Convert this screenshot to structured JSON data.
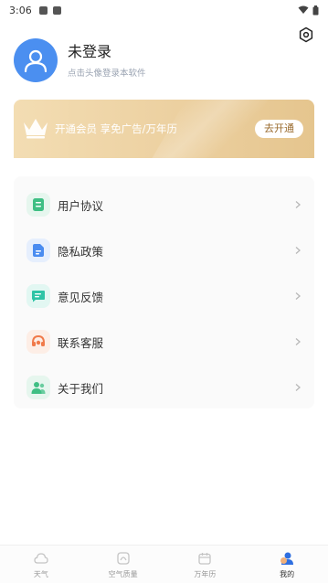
{
  "status_bar": {
    "time": "3:06"
  },
  "profile": {
    "name": "未登录",
    "hint": "点击头像登录本软件"
  },
  "vip": {
    "text": "开通会员 享免广告/万年历",
    "button": "去开通"
  },
  "menu": {
    "items": [
      {
        "label": "用户协议",
        "icon": "document-icon",
        "color": "#3fbf84",
        "bg": "#e6f6ee"
      },
      {
        "label": "隐私政策",
        "icon": "file-icon",
        "color": "#4a8cf0",
        "bg": "#e6effd"
      },
      {
        "label": "意见反馈",
        "icon": "chat-icon",
        "color": "#2ec4a6",
        "bg": "#e2f7f2"
      },
      {
        "label": "联系客服",
        "icon": "headset-icon",
        "color": "#f07a4a",
        "bg": "#fdeee6"
      },
      {
        "label": "关于我们",
        "icon": "people-icon",
        "color": "#3fbf84",
        "bg": "#e6f6ee"
      }
    ]
  },
  "bottom_nav": {
    "items": [
      {
        "label": "天气",
        "icon": "weather-icon"
      },
      {
        "label": "空气质量",
        "icon": "air-quality-icon"
      },
      {
        "label": "万年历",
        "icon": "calendar-icon"
      },
      {
        "label": "我的",
        "icon": "profile-icon",
        "active": true
      }
    ]
  },
  "colors": {
    "accent": "#4b8ff0",
    "vip_gold": "#ecd0a0"
  }
}
